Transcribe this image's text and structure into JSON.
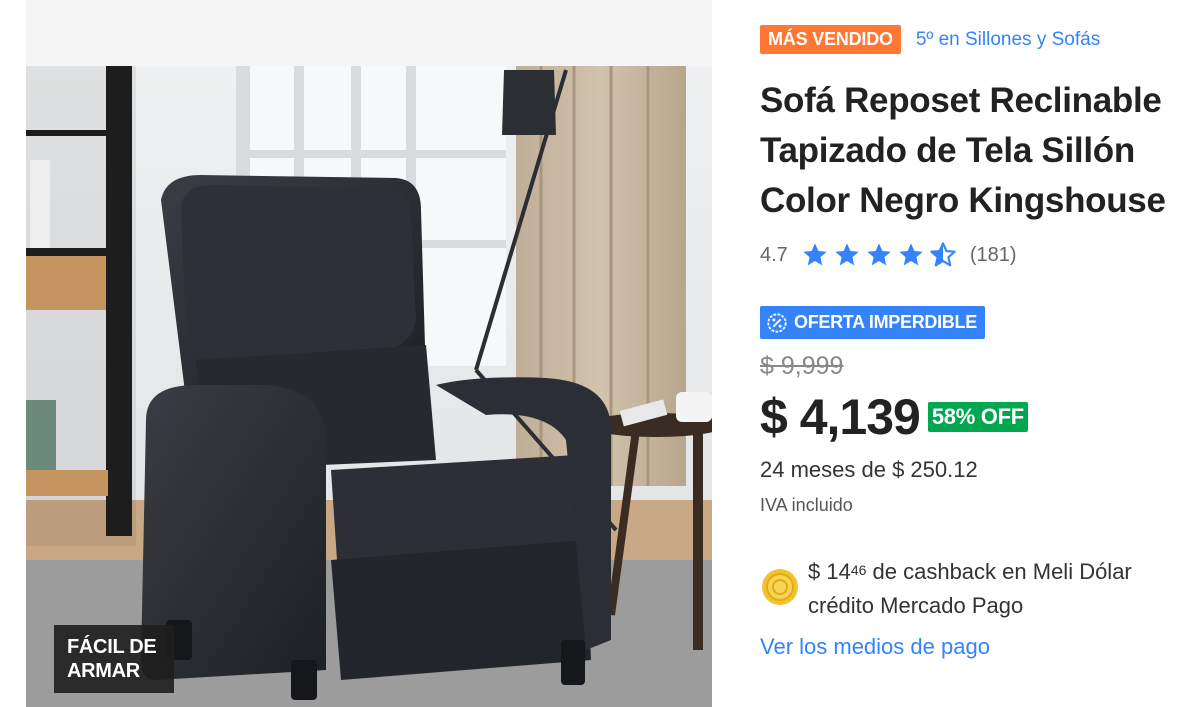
{
  "badge": {
    "best_seller": "MÁS VENDIDO",
    "rank_text": "5º en Sillones y Sofás"
  },
  "product": {
    "title_lines": [
      "Sofá Reposet Reclinable",
      "Tapizado de Tela Sillón",
      "Color Negro Kingshouse"
    ],
    "rating": "4.7",
    "stars": 4.5,
    "review_count": "(181)"
  },
  "deal": {
    "label": "OFERTA IMPERDIBLE",
    "icon": "badge-percent-icon"
  },
  "pricing": {
    "old_price": "$ 9,999",
    "price": "$ 4,139",
    "discount": "58% OFF",
    "installments": "24 meses de $ 250.12",
    "tax_note": "IVA incluido"
  },
  "cashback": {
    "amount_main": "$ 14",
    "amount_cents": "46",
    "text_1": " de cashback en Meli Dólar",
    "text_2": "crédito Mercado Pago",
    "icon": "coin-icon"
  },
  "links": {
    "payment_methods": "Ver los medios de pago"
  },
  "image": {
    "overlay_label_1": "FÁCIL DE",
    "overlay_label_2": "ARMAR"
  },
  "colors": {
    "accent": "#3483fa",
    "orange": "#ff7733",
    "green": "#00a650"
  }
}
